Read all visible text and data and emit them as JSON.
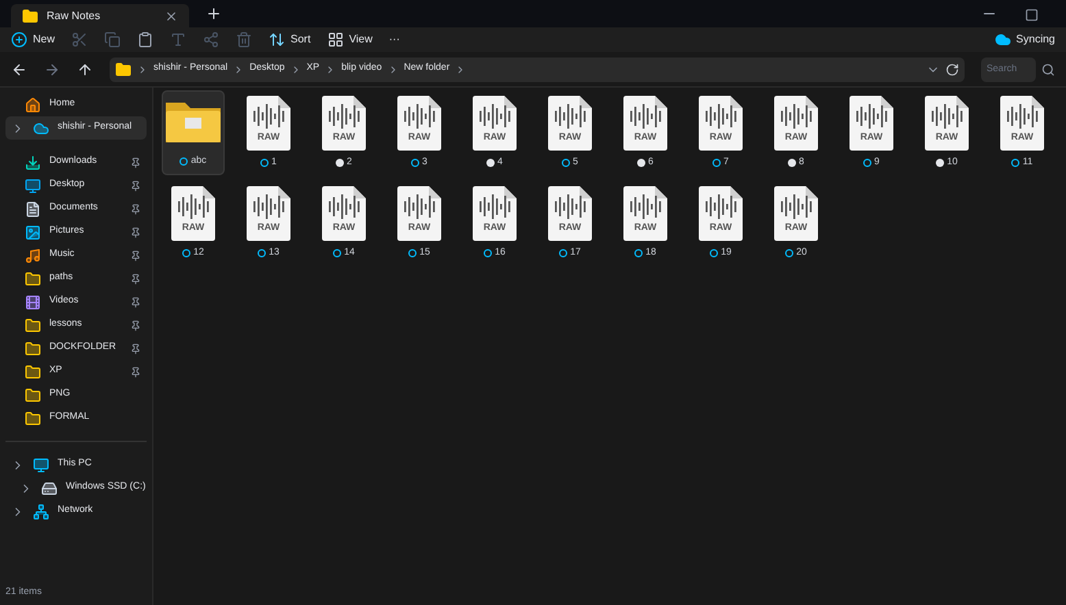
{
  "tab": {
    "title": "Raw Notes"
  },
  "toolbar": {
    "new": "New",
    "sort": "Sort",
    "view": "View",
    "more": "···",
    "sync": "Syncing"
  },
  "breadcrumb": [
    "shishir - Personal",
    "Desktop",
    "XP",
    "blip video",
    "New folder"
  ],
  "search": {
    "placeholder": "Search"
  },
  "sidebar": {
    "top": [
      {
        "label": "Home",
        "kind": "home",
        "selected": false
      },
      {
        "label": "shishir - Personal",
        "kind": "cloud",
        "selected": true
      }
    ],
    "pinned": [
      {
        "label": "Downloads",
        "kind": "download"
      },
      {
        "label": "Desktop",
        "kind": "desktop"
      },
      {
        "label": "Documents",
        "kind": "document"
      },
      {
        "label": "Pictures",
        "kind": "picture"
      },
      {
        "label": "Music",
        "kind": "music"
      },
      {
        "label": "paths",
        "kind": "folder"
      },
      {
        "label": "Videos",
        "kind": "video"
      },
      {
        "label": "lessons",
        "kind": "folder"
      },
      {
        "label": "DOCKFOLDER",
        "kind": "folder"
      },
      {
        "label": "XP",
        "kind": "folder"
      }
    ],
    "folders": [
      {
        "label": "PNG",
        "kind": "folder"
      },
      {
        "label": "FORMAL",
        "kind": "folder"
      }
    ],
    "devices": [
      {
        "label": "This PC",
        "kind": "pc",
        "children": [
          {
            "label": "Windows SSD (C:)",
            "kind": "drive"
          }
        ]
      },
      {
        "label": "Network",
        "kind": "network"
      }
    ]
  },
  "items": [
    {
      "name": "abc",
      "kind": "folder",
      "available": false,
      "selected": true
    },
    {
      "name": "1",
      "kind": "raw",
      "badge": "RAW",
      "available": false,
      "selected": false
    },
    {
      "name": "2",
      "kind": "raw",
      "badge": "RAW",
      "available": true,
      "selected": false
    },
    {
      "name": "3",
      "kind": "raw",
      "badge": "RAW",
      "available": false,
      "selected": false
    },
    {
      "name": "4",
      "kind": "raw",
      "badge": "RAW",
      "available": true,
      "selected": false
    },
    {
      "name": "5",
      "kind": "raw",
      "badge": "RAW",
      "available": false,
      "selected": false
    },
    {
      "name": "6",
      "kind": "raw",
      "badge": "RAW",
      "available": true,
      "selected": false
    },
    {
      "name": "7",
      "kind": "raw",
      "badge": "RAW",
      "available": false,
      "selected": false
    },
    {
      "name": "8",
      "kind": "raw",
      "badge": "RAW",
      "available": true,
      "selected": false
    },
    {
      "name": "9",
      "kind": "raw",
      "badge": "RAW",
      "available": false,
      "selected": false
    },
    {
      "name": "10",
      "kind": "raw",
      "badge": "RAW",
      "available": true,
      "selected": false
    },
    {
      "name": "11",
      "kind": "raw",
      "badge": "RAW",
      "available": false,
      "selected": false
    },
    {
      "name": "12",
      "kind": "raw",
      "badge": "RAW",
      "available": false,
      "selected": false
    },
    {
      "name": "13",
      "kind": "raw",
      "badge": "RAW",
      "available": false,
      "selected": false
    },
    {
      "name": "14",
      "kind": "raw",
      "badge": "RAW",
      "available": false,
      "selected": false
    },
    {
      "name": "15",
      "kind": "raw",
      "badge": "RAW",
      "available": false,
      "selected": false
    },
    {
      "name": "16",
      "kind": "raw",
      "badge": "RAW",
      "available": false,
      "selected": false
    },
    {
      "name": "17",
      "kind": "raw",
      "badge": "RAW",
      "available": false,
      "selected": false
    },
    {
      "name": "18",
      "kind": "raw",
      "badge": "RAW",
      "available": false,
      "selected": false
    },
    {
      "name": "19",
      "kind": "raw",
      "badge": "RAW",
      "available": false,
      "selected": false
    },
    {
      "name": "20",
      "kind": "raw",
      "badge": "RAW",
      "available": false,
      "selected": false
    }
  ],
  "status_bar": {
    "count": "21 items"
  }
}
